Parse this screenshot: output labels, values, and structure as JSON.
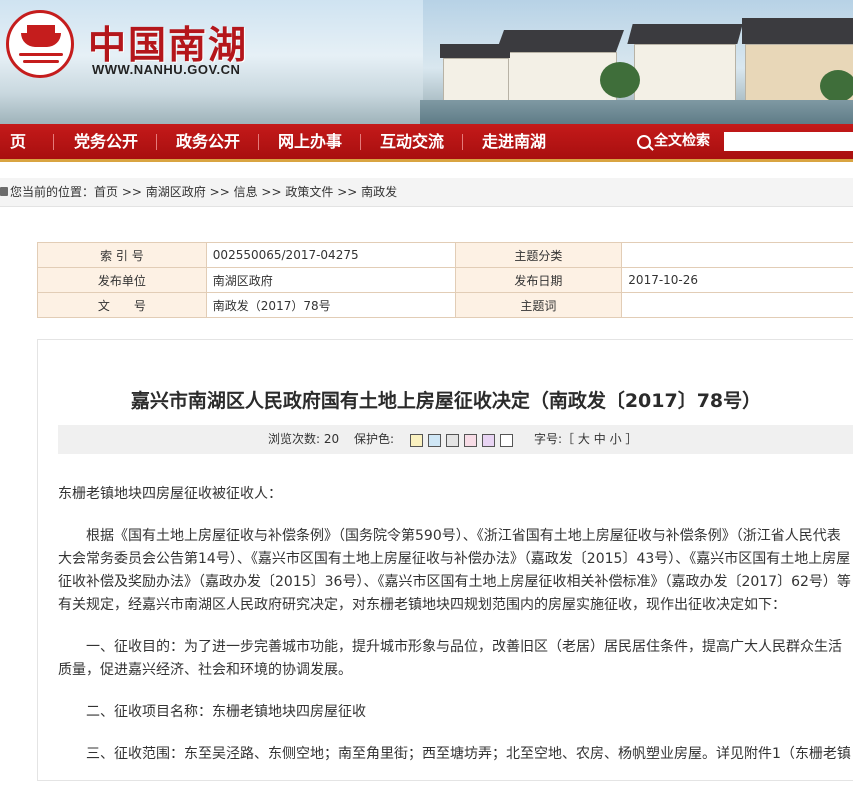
{
  "site": {
    "title": "中国南湖",
    "url": "WWW.NANHU.GOV.CN"
  },
  "nav": {
    "items": [
      "页",
      "党务公开",
      "政务公开",
      "网上办事",
      "互动交流",
      "走进南湖"
    ],
    "search_label": "全文检索",
    "search_placeholder": ""
  },
  "breadcrumb": {
    "prefix": "您当前的位置：",
    "items": [
      "首页",
      "南湖区政府",
      "信息",
      "政策文件",
      "南政发"
    ],
    "separator": ">>"
  },
  "meta": {
    "index_label": "索 引 号",
    "index_value": "002550065/2017-04275",
    "topic_label": "主题分类",
    "topic_value": "",
    "publisher_label": "发布单位",
    "publisher_value": "南湖区政府",
    "date_label": "发布日期",
    "date_value": "2017-10-26",
    "docno_label": "文　　号",
    "docno_value": "南政发（2017）78号",
    "keywords_label": "主题词",
    "keywords_value": ""
  },
  "article": {
    "title": "嘉兴市南湖区人民政府国有土地上房屋征收决定（南政发〔2017〕78号）",
    "views_label": "浏览次数: 20",
    "protect_label": "保护色:",
    "protect_colors": [
      "#faf1c0",
      "#cfe6f5",
      "#e4e4e4",
      "#f7dce6",
      "#e8d4f3",
      "#ffffff"
    ],
    "size_prefix": "字号:［",
    "size_large": "大",
    "size_medium": "中",
    "size_small": "小",
    "size_suffix": "］",
    "paragraphs": [
      "东栅老镇地块四房屋征收被征收人：",
      "根据《国有土地上房屋征收与补偿条例》（国务院令第590号）、《浙江省国有土地上房屋征收与补偿条例》（浙江省人民代表大会常务委员会公告第14号）、《嘉兴市区国有土地上房屋征收与补偿办法》（嘉政发〔2015〕43号）、《嘉兴市区国有土地上房屋征收补偿及奖励办法》（嘉政办发〔2015〕36号）、《嘉兴市区国有土地上房屋征收相关补偿标准》（嘉政办发〔2017〕62号）等有关规定，经嘉兴市南湖区人民政府研究决定，对东栅老镇地块四规划范围内的房屋实施征收，现作出征收决定如下：",
      "一、征收目的：为了进一步完善城市功能，提升城市形象与品位，改善旧区（老居）居民居住条件，提高广大人民群众生活质量，促进嘉兴经济、社会和环境的协调发展。",
      "二、征收项目名称：东栅老镇地块四房屋征收",
      "三、征收范围：东至吴泾路、东侧空地；南至角里街；西至塘坊弄；北至空地、农房、杨帆塑业房屋。详见附件1（东栅老镇"
    ]
  }
}
